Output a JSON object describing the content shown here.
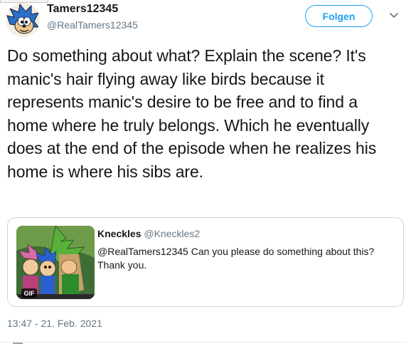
{
  "tweet": {
    "author_name": "Tamers12345",
    "author_handle": "@RealTamers12345",
    "follow_label": "Folgen",
    "text": "Do something about what? Explain the scene? It's manic's hair flying away like birds because it represents manic's desire to be free and to find a home where he truly belongs. Which he eventually does at the end of the episode when he realizes his home is where his sibs are.",
    "timestamp": "13:47 - 21. Feb. 2021"
  },
  "quote": {
    "author_name": "Kneckles",
    "author_handle": "@Kneckles2",
    "text": "@RealTamers12345  Can you please do something about this?\nThank you.",
    "media_badge": "GIF"
  },
  "colors": {
    "accent": "#1da1f2",
    "secondary_text": "#657786",
    "border": "#ccd6dd"
  },
  "icons": {
    "caret": "chevron-down-icon",
    "avatar": "sonic-avatar"
  }
}
